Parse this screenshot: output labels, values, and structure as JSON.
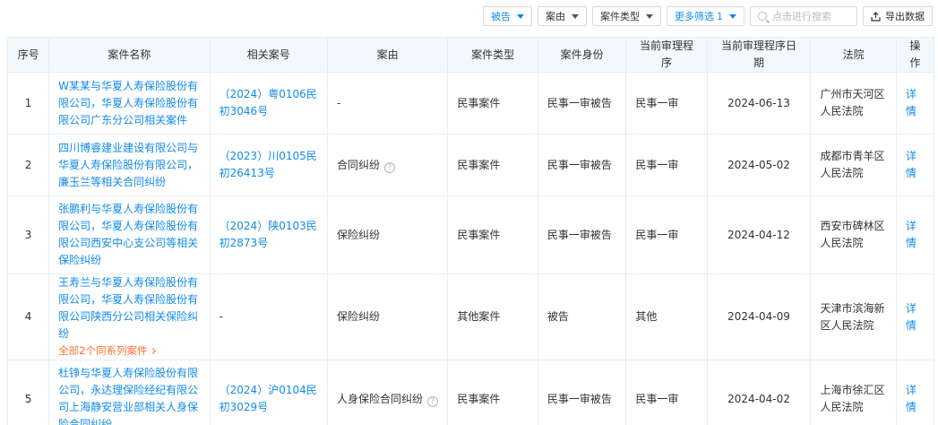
{
  "toolbar": {
    "filter_defendant": "被告",
    "filter_cause": "案由",
    "filter_case_type": "案件类型",
    "more_filters": "更多筛选",
    "more_filters_count": "1",
    "search_placeholder": "点击进行搜索",
    "export_label": "导出数据"
  },
  "table": {
    "headers": [
      "序号",
      "案件名称",
      "相关案号",
      "案由",
      "案件类型",
      "案件身份",
      "当前审理程序",
      "当前审理程序日期",
      "法院",
      "操作"
    ],
    "rows": [
      {
        "index": "1",
        "case_name": "W某某与华夏人寿保险股份有限公司，华夏人寿保险股份有限公司广东分公司相关案件",
        "case_no": "（2024）粤0106民初3046号",
        "cause": "-",
        "cause_help": false,
        "case_type": "民事案件",
        "role": "民事一审被告",
        "procedure": "民事一审",
        "date": "2024-06-13",
        "court": "广州市天河区人民法院",
        "action": "详情"
      },
      {
        "index": "2",
        "case_name": "四川博睿建业建设有限公司与华夏人寿保险股份有限公司，廉玉兰等相关合同纠纷",
        "case_no": "（2023）川0105民初26413号",
        "cause": "合同纠纷",
        "cause_help": true,
        "case_type": "民事案件",
        "role": "民事一审被告",
        "procedure": "民事一审",
        "date": "2024-05-02",
        "court": "成都市青羊区人民法院",
        "action": "详情"
      },
      {
        "index": "3",
        "case_name": "张鹏利与华夏人寿保险股份有限公司，华夏人寿保险股份有限公司西安中心支公司等相关保险纠纷",
        "case_no": "（2024）陕0103民初2873号",
        "cause": "保险纠纷",
        "cause_help": false,
        "case_type": "民事案件",
        "role": "民事一审被告",
        "procedure": "民事一审",
        "date": "2024-04-12",
        "court": "西安市碑林区人民法院",
        "action": "详情"
      },
      {
        "index": "4",
        "case_name": "王寿兰与华夏人寿保险股份有限公司，华夏人寿保险股份有限公司陕西分公司相关保险纠纷",
        "series_link": "全部2个同系列案件",
        "case_no": "-",
        "cause": "保险纠纷",
        "cause_help": false,
        "case_type": "其他案件",
        "role": "被告",
        "procedure": "其他",
        "date": "2024-04-09",
        "court": "天津市滨海新区人民法院",
        "action": "详情"
      },
      {
        "index": "5",
        "case_name": "杜铮与华夏人寿保险股份有限公司，永达理保险经纪有限公司上海静安营业部相关人身保险合同纠纷",
        "case_no": "（2024）沪0104民初3029号",
        "cause": "人身保险合同纠纷",
        "cause_help": true,
        "case_type": "民事案件",
        "role": "民事一审被告",
        "procedure": "民事一审",
        "date": "2024-04-02",
        "court": "上海市徐汇区人民法院",
        "action": "详情"
      }
    ]
  },
  "icons": {
    "search": "search-icon",
    "export": "export-icon",
    "help": "question-circle-icon",
    "chevron": "chevron-right-icon"
  },
  "colors": {
    "link": "#128bed",
    "accent_orange": "#ff722d",
    "header_bg": "#f2f9fc",
    "border": "#e4eef6"
  }
}
